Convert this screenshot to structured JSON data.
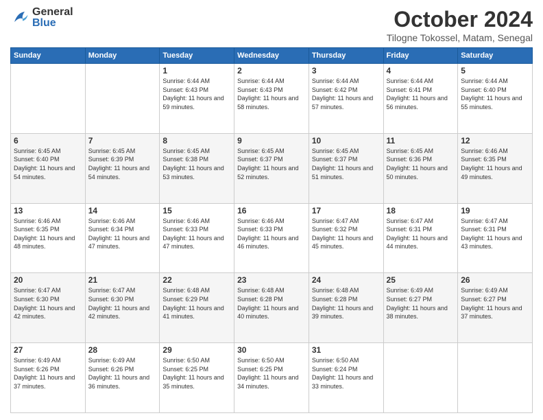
{
  "header": {
    "logo_general": "General",
    "logo_blue": "Blue",
    "month": "October 2024",
    "location": "Tilogne Tokossel, Matam, Senegal"
  },
  "weekdays": [
    "Sunday",
    "Monday",
    "Tuesday",
    "Wednesday",
    "Thursday",
    "Friday",
    "Saturday"
  ],
  "weeks": [
    [
      {
        "day": "",
        "sunrise": "",
        "sunset": "",
        "daylight": ""
      },
      {
        "day": "",
        "sunrise": "",
        "sunset": "",
        "daylight": ""
      },
      {
        "day": "1",
        "sunrise": "Sunrise: 6:44 AM",
        "sunset": "Sunset: 6:43 PM",
        "daylight": "Daylight: 11 hours and 59 minutes."
      },
      {
        "day": "2",
        "sunrise": "Sunrise: 6:44 AM",
        "sunset": "Sunset: 6:43 PM",
        "daylight": "Daylight: 11 hours and 58 minutes."
      },
      {
        "day": "3",
        "sunrise": "Sunrise: 6:44 AM",
        "sunset": "Sunset: 6:42 PM",
        "daylight": "Daylight: 11 hours and 57 minutes."
      },
      {
        "day": "4",
        "sunrise": "Sunrise: 6:44 AM",
        "sunset": "Sunset: 6:41 PM",
        "daylight": "Daylight: 11 hours and 56 minutes."
      },
      {
        "day": "5",
        "sunrise": "Sunrise: 6:44 AM",
        "sunset": "Sunset: 6:40 PM",
        "daylight": "Daylight: 11 hours and 55 minutes."
      }
    ],
    [
      {
        "day": "6",
        "sunrise": "Sunrise: 6:45 AM",
        "sunset": "Sunset: 6:40 PM",
        "daylight": "Daylight: 11 hours and 54 minutes."
      },
      {
        "day": "7",
        "sunrise": "Sunrise: 6:45 AM",
        "sunset": "Sunset: 6:39 PM",
        "daylight": "Daylight: 11 hours and 54 minutes."
      },
      {
        "day": "8",
        "sunrise": "Sunrise: 6:45 AM",
        "sunset": "Sunset: 6:38 PM",
        "daylight": "Daylight: 11 hours and 53 minutes."
      },
      {
        "day": "9",
        "sunrise": "Sunrise: 6:45 AM",
        "sunset": "Sunset: 6:37 PM",
        "daylight": "Daylight: 11 hours and 52 minutes."
      },
      {
        "day": "10",
        "sunrise": "Sunrise: 6:45 AM",
        "sunset": "Sunset: 6:37 PM",
        "daylight": "Daylight: 11 hours and 51 minutes."
      },
      {
        "day": "11",
        "sunrise": "Sunrise: 6:45 AM",
        "sunset": "Sunset: 6:36 PM",
        "daylight": "Daylight: 11 hours and 50 minutes."
      },
      {
        "day": "12",
        "sunrise": "Sunrise: 6:46 AM",
        "sunset": "Sunset: 6:35 PM",
        "daylight": "Daylight: 11 hours and 49 minutes."
      }
    ],
    [
      {
        "day": "13",
        "sunrise": "Sunrise: 6:46 AM",
        "sunset": "Sunset: 6:35 PM",
        "daylight": "Daylight: 11 hours and 48 minutes."
      },
      {
        "day": "14",
        "sunrise": "Sunrise: 6:46 AM",
        "sunset": "Sunset: 6:34 PM",
        "daylight": "Daylight: 11 hours and 47 minutes."
      },
      {
        "day": "15",
        "sunrise": "Sunrise: 6:46 AM",
        "sunset": "Sunset: 6:33 PM",
        "daylight": "Daylight: 11 hours and 47 minutes."
      },
      {
        "day": "16",
        "sunrise": "Sunrise: 6:46 AM",
        "sunset": "Sunset: 6:33 PM",
        "daylight": "Daylight: 11 hours and 46 minutes."
      },
      {
        "day": "17",
        "sunrise": "Sunrise: 6:47 AM",
        "sunset": "Sunset: 6:32 PM",
        "daylight": "Daylight: 11 hours and 45 minutes."
      },
      {
        "day": "18",
        "sunrise": "Sunrise: 6:47 AM",
        "sunset": "Sunset: 6:31 PM",
        "daylight": "Daylight: 11 hours and 44 minutes."
      },
      {
        "day": "19",
        "sunrise": "Sunrise: 6:47 AM",
        "sunset": "Sunset: 6:31 PM",
        "daylight": "Daylight: 11 hours and 43 minutes."
      }
    ],
    [
      {
        "day": "20",
        "sunrise": "Sunrise: 6:47 AM",
        "sunset": "Sunset: 6:30 PM",
        "daylight": "Daylight: 11 hours and 42 minutes."
      },
      {
        "day": "21",
        "sunrise": "Sunrise: 6:47 AM",
        "sunset": "Sunset: 6:30 PM",
        "daylight": "Daylight: 11 hours and 42 minutes."
      },
      {
        "day": "22",
        "sunrise": "Sunrise: 6:48 AM",
        "sunset": "Sunset: 6:29 PM",
        "daylight": "Daylight: 11 hours and 41 minutes."
      },
      {
        "day": "23",
        "sunrise": "Sunrise: 6:48 AM",
        "sunset": "Sunset: 6:28 PM",
        "daylight": "Daylight: 11 hours and 40 minutes."
      },
      {
        "day": "24",
        "sunrise": "Sunrise: 6:48 AM",
        "sunset": "Sunset: 6:28 PM",
        "daylight": "Daylight: 11 hours and 39 minutes."
      },
      {
        "day": "25",
        "sunrise": "Sunrise: 6:49 AM",
        "sunset": "Sunset: 6:27 PM",
        "daylight": "Daylight: 11 hours and 38 minutes."
      },
      {
        "day": "26",
        "sunrise": "Sunrise: 6:49 AM",
        "sunset": "Sunset: 6:27 PM",
        "daylight": "Daylight: 11 hours and 37 minutes."
      }
    ],
    [
      {
        "day": "27",
        "sunrise": "Sunrise: 6:49 AM",
        "sunset": "Sunset: 6:26 PM",
        "daylight": "Daylight: 11 hours and 37 minutes."
      },
      {
        "day": "28",
        "sunrise": "Sunrise: 6:49 AM",
        "sunset": "Sunset: 6:26 PM",
        "daylight": "Daylight: 11 hours and 36 minutes."
      },
      {
        "day": "29",
        "sunrise": "Sunrise: 6:50 AM",
        "sunset": "Sunset: 6:25 PM",
        "daylight": "Daylight: 11 hours and 35 minutes."
      },
      {
        "day": "30",
        "sunrise": "Sunrise: 6:50 AM",
        "sunset": "Sunset: 6:25 PM",
        "daylight": "Daylight: 11 hours and 34 minutes."
      },
      {
        "day": "31",
        "sunrise": "Sunrise: 6:50 AM",
        "sunset": "Sunset: 6:24 PM",
        "daylight": "Daylight: 11 hours and 33 minutes."
      },
      {
        "day": "",
        "sunrise": "",
        "sunset": "",
        "daylight": ""
      },
      {
        "day": "",
        "sunrise": "",
        "sunset": "",
        "daylight": ""
      }
    ]
  ]
}
